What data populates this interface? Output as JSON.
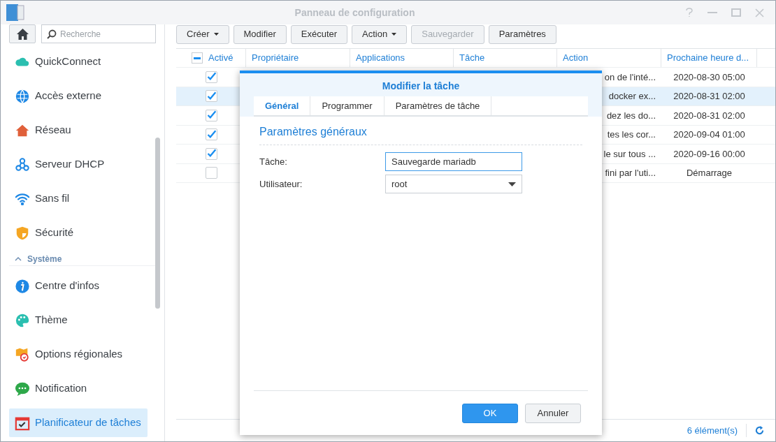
{
  "window": {
    "title": "Panneau de configuration"
  },
  "sidebar": {
    "search": {
      "placeholder": "Recherche"
    },
    "items": [
      {
        "kind": "item",
        "label": "QuickConnect",
        "selected": false
      },
      {
        "kind": "item",
        "label": "Accès externe",
        "selected": false
      },
      {
        "kind": "item",
        "label": "Réseau",
        "selected": false
      },
      {
        "kind": "item",
        "label": "Serveur DHCP",
        "selected": false
      },
      {
        "kind": "item",
        "label": "Sans fil",
        "selected": false
      },
      {
        "kind": "item",
        "label": "Sécurité",
        "selected": false
      },
      {
        "kind": "section",
        "label": "Système",
        "expanded": true
      },
      {
        "kind": "item",
        "label": "Centre d'infos",
        "selected": false
      },
      {
        "kind": "item",
        "label": "Thème",
        "selected": false
      },
      {
        "kind": "item",
        "label": "Options régionales",
        "selected": false
      },
      {
        "kind": "item",
        "label": "Notification",
        "selected": false
      },
      {
        "kind": "item",
        "label": "Planificateur de tâches",
        "selected": true
      }
    ]
  },
  "toolbar": [
    {
      "label": "Créer",
      "dropdown": true,
      "disabled": false
    },
    {
      "label": "Modifier",
      "dropdown": false,
      "disabled": false
    },
    {
      "label": "Exécuter",
      "dropdown": false,
      "disabled": false
    },
    {
      "label": "Action",
      "dropdown": true,
      "disabled": false
    },
    {
      "label": "Sauvegarder",
      "dropdown": false,
      "disabled": true
    },
    {
      "label": "Paramètres",
      "dropdown": false,
      "disabled": false
    }
  ],
  "table": {
    "header_checkbox": {
      "indeterminate": true
    },
    "columns": [
      "Activé",
      "Propriétaire",
      "Applications",
      "Tâche",
      "Action",
      "Prochaine heure d..."
    ],
    "rows": [
      {
        "checked": true,
        "selected": false,
        "action": "on de l'inté...",
        "next": "2020-08-30 05:00"
      },
      {
        "checked": true,
        "selected": true,
        "action": "docker ex...",
        "next": "2020-08-31 02:00"
      },
      {
        "checked": true,
        "selected": false,
        "action": "dez les do...",
        "next": "2020-08-31 02:00"
      },
      {
        "checked": true,
        "selected": false,
        "action": "tes les cor...",
        "next": "2020-09-04 01:00"
      },
      {
        "checked": true,
        "selected": false,
        "action": "le sur tous ...",
        "next": "2020-09-16 00:00"
      },
      {
        "checked": false,
        "selected": false,
        "action": "fini par l'uti...",
        "next": "Démarrage"
      }
    ],
    "count": "6 élément(s)"
  },
  "dialog": {
    "title": "Modifier la tâche",
    "tabs": [
      {
        "label": "Général",
        "selected": true
      },
      {
        "label": "Programmer",
        "selected": false
      },
      {
        "label": "Paramètres de tâche",
        "selected": false
      }
    ],
    "section": "Paramètres généraux",
    "fields": [
      {
        "kind": "text",
        "label": "Tâche:",
        "value": "Sauvegarde mariadb"
      },
      {
        "kind": "select",
        "label": "Utilisateur:",
        "value": "root"
      }
    ],
    "buttons": [
      {
        "kind": "primary",
        "label": "OK"
      },
      {
        "kind": "secondary",
        "label": "Annuler"
      }
    ]
  }
}
